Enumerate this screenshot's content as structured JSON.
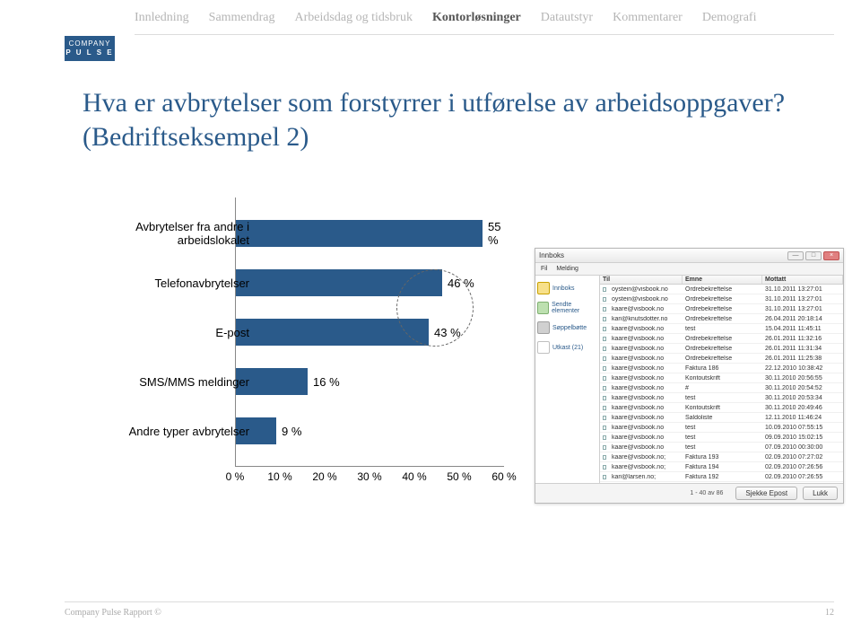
{
  "logo": {
    "line1": "COMPANY",
    "line2": "P U L S E"
  },
  "nav": {
    "items": [
      {
        "label": "Innledning",
        "active": false
      },
      {
        "label": "Sammendrag",
        "active": false
      },
      {
        "label": "Arbeidsdag og tidsbruk",
        "active": false
      },
      {
        "label": "Kontorløsninger",
        "active": true
      },
      {
        "label": "Datautstyr",
        "active": false
      },
      {
        "label": "Kommentarer",
        "active": false
      },
      {
        "label": "Demografi",
        "active": false
      }
    ]
  },
  "title": "Hva er avbrytelser som forstyrrer i utførelse av arbeidsoppgaver? (Bedriftseksempel 2)",
  "chart_data": {
    "type": "bar",
    "orientation": "horizontal",
    "categories": [
      "Avbrytelser fra andre i arbeidslokalet",
      "Telefonavbrytelser",
      "E-post",
      "SMS/MMS meldinger",
      "Andre typer avbrytelser"
    ],
    "values": [
      55,
      46,
      43,
      16,
      9
    ],
    "value_labels": [
      "55 %",
      "46 %",
      "43 %",
      "16 %",
      "9 %"
    ],
    "x_ticks": [
      "0 %",
      "10 %",
      "20 %",
      "30 %",
      "40 %",
      "50 %",
      "60 %"
    ],
    "xlim": [
      0,
      60
    ],
    "bar_color": "#2a5a8a",
    "highlight_circle_around": [
      1,
      2
    ]
  },
  "mail": {
    "window_title": "Innboks",
    "menus": [
      "Fil",
      "Melding"
    ],
    "folders": [
      {
        "label": "Innboks",
        "kind": "y"
      },
      {
        "label": "Sendte elementer",
        "kind": "g"
      },
      {
        "label": "Søppelbøtte",
        "kind": "b"
      },
      {
        "label": "Utkast (21)",
        "kind": "o"
      }
    ],
    "columns": {
      "from": "Til",
      "subject": "Emne",
      "received": "Mottatt"
    },
    "rows": [
      {
        "from": "oystein@visbook.no",
        "subject": "Ordrebekreftelse",
        "date": "31.10.2011 13:27:01"
      },
      {
        "from": "oystein@visbook.no",
        "subject": "Ordrebekreftelse",
        "date": "31.10.2011 13:27:01"
      },
      {
        "from": "kaare@visbook.no",
        "subject": "Ordrebekreftelse",
        "date": "31.10.2011 13:27:01"
      },
      {
        "from": "kari@knutsdotter.no",
        "subject": "Ordrebekreftelse",
        "date": "26.04.2011 20:18:14"
      },
      {
        "from": "kaare@visbook.no",
        "subject": "test",
        "date": "15.04.2011 11:45:11"
      },
      {
        "from": "kaare@visbook.no",
        "subject": "Ordrebekreftelse",
        "date": "26.01.2011 11:32:16"
      },
      {
        "from": "kaare@visbook.no",
        "subject": "Ordrebekreftelse",
        "date": "26.01.2011 11:31:34"
      },
      {
        "from": "kaare@visbook.no",
        "subject": "Ordrebekreftelse",
        "date": "26.01.2011 11:25:38"
      },
      {
        "from": "kaare@visbook.no",
        "subject": "Faktura 186",
        "date": "22.12.2010 10:38:42"
      },
      {
        "from": "kaare@visbook.no",
        "subject": "Kontoutskrift",
        "date": "30.11.2010 20:56:55"
      },
      {
        "from": "kaare@visbook.no",
        "subject": "#",
        "date": "30.11.2010 20:54:52"
      },
      {
        "from": "kaare@visbook.no",
        "subject": "test",
        "date": "30.11.2010 20:53:34"
      },
      {
        "from": "kaare@visbook.no",
        "subject": "Kontoutskrift",
        "date": "30.11.2010 20:49:46"
      },
      {
        "from": "kaare@visbook.no",
        "subject": "Saldoliste",
        "date": "12.11.2010 11:46:24"
      },
      {
        "from": "kaare@visbook.no",
        "subject": "test",
        "date": "10.09.2010 07:55:15"
      },
      {
        "from": "kaare@visbook.no",
        "subject": "test",
        "date": "09.09.2010 15:02:15"
      },
      {
        "from": "kaare@visbook.no",
        "subject": "test",
        "date": "07.09.2010 00:30:00"
      },
      {
        "from": "kaare@visbook.no;",
        "subject": "Faktura 193",
        "date": "02.09.2010 07:27:02"
      },
      {
        "from": "kaare@visbook.no;",
        "subject": "Faktura 194",
        "date": "02.09.2010 07:26:56"
      },
      {
        "from": "kari@larsen.no;",
        "subject": "Faktura 192",
        "date": "02.09.2010 07:26:55"
      }
    ],
    "count_label": "1 - 40 av 86",
    "btn_check": "Sjekke Epost",
    "btn_close": "Lukk"
  },
  "footer": {
    "left": "Company Pulse Rapport ©",
    "right": "12"
  }
}
